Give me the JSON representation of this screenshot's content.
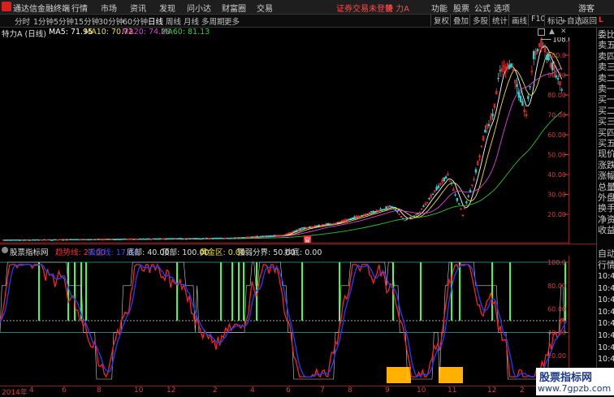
{
  "app": {
    "name": "通达信金融终端"
  },
  "menu": {
    "items": [
      "行情",
      "市场",
      "资讯",
      "发现",
      "问小达",
      "财富圈",
      "交易"
    ],
    "warning": "证券交易未登录",
    "stock_tag": "特 力A",
    "right_items": [
      "功能",
      "股票",
      "公式",
      "选项"
    ],
    "user": "游客"
  },
  "periods": [
    "分时",
    "1分钟",
    "5分钟",
    "15分钟",
    "30分钟",
    "60分钟",
    "日线",
    "周线",
    "月线",
    "多周期",
    "更多"
  ],
  "period_active": "日线",
  "toolbar": [
    "复权",
    "叠加",
    "多股",
    "统计",
    "画线",
    "F10",
    "标记",
    "返回"
  ],
  "toolbar2": [
    "+自选",
    "返回"
  ],
  "title_row": {
    "stock": "特力A (日线)",
    "ma5": "MA5: 71.95",
    "ma10": "MA10: 70.72",
    "ma20": "MA20: 74.28",
    "ma60": "MA60: 81.13"
  },
  "sidebar": {
    "labels": [
      "委比",
      "卖五",
      "卖四",
      "卖三",
      "卖二",
      "卖一",
      "买一",
      "买二",
      "买三",
      "买四",
      "买五",
      "现价",
      "涨跌",
      "涨幅",
      "总量",
      "外盘",
      "换手",
      "净资",
      "收益"
    ],
    "labels2": [
      "自动",
      "行情"
    ],
    "clocks": [
      "10:4",
      "10:4",
      "10:4",
      "10:4",
      "10:4",
      "10:4",
      "10:4",
      "10:4",
      "10:4",
      "10:4"
    ]
  },
  "price_axis": [
    "100.0",
    "90.00",
    "80.00",
    "70.00",
    "60.00",
    "50.00",
    "40.00",
    "30.00",
    "20.00"
  ],
  "price_annotations": {
    "high": "108.00",
    "low": "6.22",
    "marker": "窗"
  },
  "indicator_title": {
    "name": "股票指标网",
    "trend": "趋势线: 27.00",
    "cross": "操盘线: 17.64",
    "bottom": "底部: 40.00",
    "top": "顶部: 100.00",
    "gold": "黄金区: 0.00",
    "bound": "强弱分界: 50.00",
    "buy": "抄底: 0.00"
  },
  "indicator_axis": [
    "100.0",
    "80.00",
    "60.00",
    "40.00",
    "20.00"
  ],
  "date_axis": [
    "2014年",
    "4",
    "6",
    "8",
    "10",
    "12",
    "2",
    "4",
    "6",
    "7",
    "8",
    "9",
    "10",
    "11",
    "12",
    "2"
  ],
  "watermark": {
    "title": "股票指标网",
    "url": "www.7gpzb.com"
  },
  "colors": {
    "up": "#ff3030",
    "down": "#30d0d0",
    "ma5": "#ffffff",
    "ma10": "#f0e020",
    "ma20": "#e040e0",
    "ma60": "#30c030",
    "trend": "#ff2020",
    "cross": "#2040ff",
    "axis": "#d04040",
    "green_bar": "#40ff40",
    "gold": "#ffb000"
  }
}
